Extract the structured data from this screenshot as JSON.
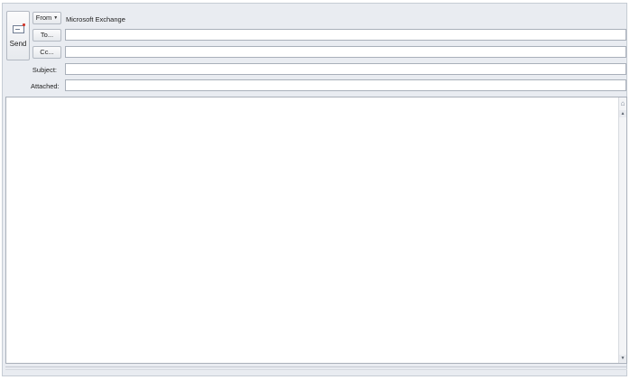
{
  "header": {
    "send_label": "Send",
    "from_label": "From",
    "from_value": "Microsoft Exchange",
    "to_label": "To...",
    "cc_label": "Cc...",
    "subject_label": "Subject:",
    "attached_label": "Attached:"
  },
  "fields": {
    "to": "",
    "cc": "",
    "subject": "",
    "attached": ""
  },
  "body": {
    "text": ""
  },
  "icons": {
    "send": "send-mail-icon",
    "from_dropdown": "chevron-down-icon",
    "ruler": "ruler-icon",
    "scroll_up": "arrow-up-icon",
    "scroll_down": "arrow-down-icon"
  }
}
